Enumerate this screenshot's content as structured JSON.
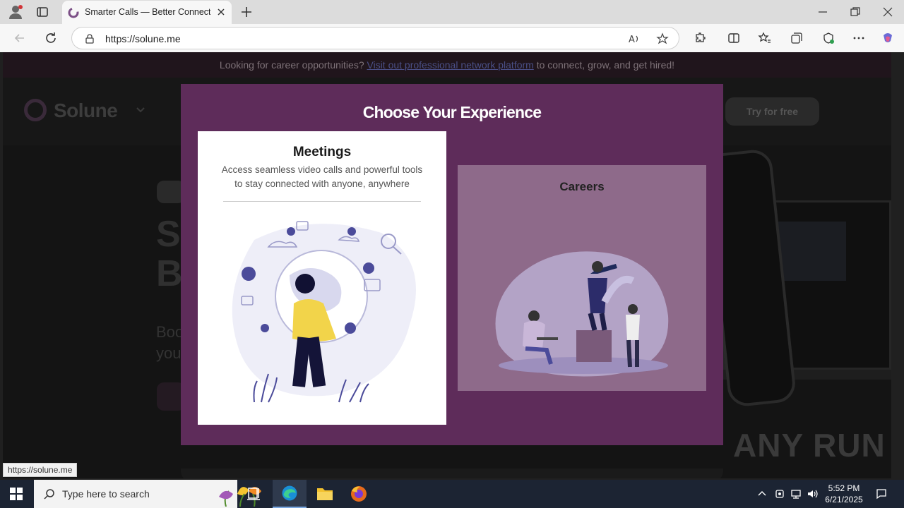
{
  "browser": {
    "tab_title": "Smarter Calls — Better Connections",
    "url": "https://solune.me",
    "status_url": "https://solune.me"
  },
  "page": {
    "banner": {
      "text_before": "Looking for career opportunities?",
      "link_text": "Visit out professional network platform",
      "text_after": "to connect, grow, and get hired!"
    },
    "logo_text": "Solune",
    "try_button": "Try for free",
    "hero_heading_partial": [
      "S",
      "B"
    ],
    "hero_sub_partial": [
      "Boo",
      "you"
    ],
    "watermark": "ANY RUN"
  },
  "modal": {
    "title": "Choose Your Experience",
    "meetings": {
      "title": "Meetings",
      "description": "Access seamless video calls and powerful tools to stay connected with anyone, anywhere"
    },
    "careers": {
      "title": "Careers"
    }
  },
  "taskbar": {
    "search_placeholder": "Type here to search",
    "time": "5:52 PM",
    "date": "6/21/2025"
  },
  "colors": {
    "modal_bg": "#5e2c5a",
    "careers_card_bg": "#8e6a8a",
    "illustration_accent": "#4b4b9a"
  }
}
